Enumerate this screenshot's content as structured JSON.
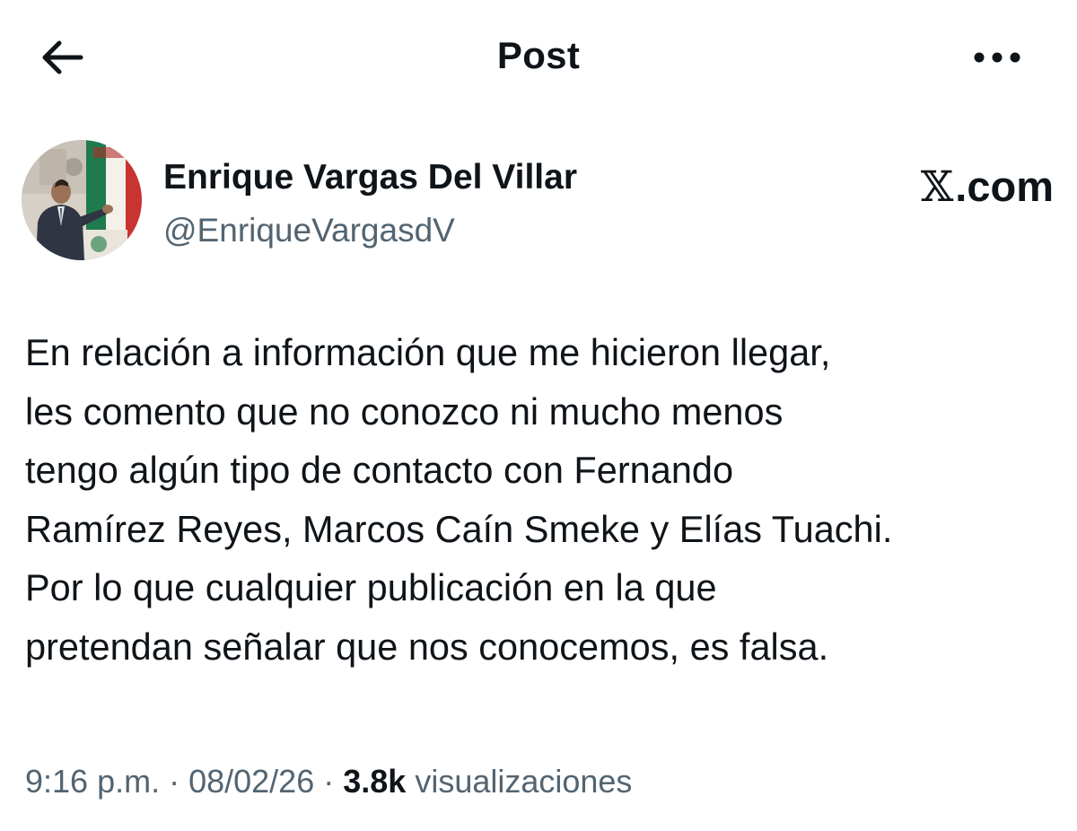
{
  "header": {
    "title": "Post",
    "back_icon": "arrow-left-icon",
    "more_icon": "more-horizontal-icon"
  },
  "author": {
    "name": "Enrique Vargas Del Villar",
    "handle": "@EnriqueVargasdV",
    "avatar_icon": "profile-photo"
  },
  "brand": {
    "x": "𝕏",
    "text": ".com"
  },
  "post": {
    "lines": [
      "En relación a información que me hicieron llegar,",
      "les comento que no conozco ni mucho menos",
      "tengo algún tipo de contacto con Fernando",
      "Ramírez Reyes, Marcos Caín Smeke y Elías Tuachi.",
      "Por lo que cualquier publicación en la que",
      "pretendan señalar que nos conocemos, es falsa."
    ]
  },
  "meta": {
    "time": "9:16 p.m.",
    "separator1": " · ",
    "date": "08/02/26",
    "separator2": " · ",
    "views_count": "3.8k",
    "views_label": " visualizaciones"
  },
  "colors": {
    "text_primary": "#0f1419",
    "text_secondary": "#536471",
    "background": "#ffffff"
  }
}
